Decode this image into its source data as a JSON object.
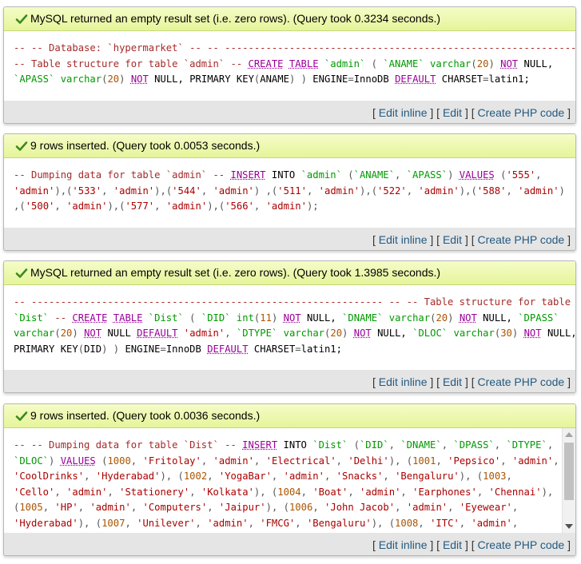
{
  "actions": {
    "edit_inline": "Edit inline",
    "edit": "Edit",
    "create_php": "Create PHP code"
  },
  "colors": {
    "comment": "#a52a2a",
    "keyword": "#990099",
    "type": "#009900",
    "string": "#aa0000",
    "number": "#aa5500",
    "link": "#235a81",
    "message_bg": "#ebf8a4"
  },
  "results": [
    {
      "message": "MySQL returned an empty result set (i.e. zero rows). (Query took 0.3234 seconds.)",
      "icon": "check-icon",
      "sql_lines": [
        [
          [
            "cm",
            "-- -- Database: `hypermarket` -- -- ------------------------------------------------------------ --"
          ]
        ],
        [
          [
            "cm",
            "-- Table structure for table `admin` -- "
          ],
          [
            "kw",
            "CREATE"
          ],
          [
            "nk",
            " "
          ],
          [
            "kw",
            "TABLE"
          ],
          [
            "nk",
            " "
          ],
          [
            "ty",
            "`admin`"
          ],
          [
            "nk",
            " "
          ],
          [
            "pu",
            "("
          ],
          [
            "nk",
            " "
          ],
          [
            "ty",
            "`ANAME`"
          ],
          [
            "nk",
            " "
          ],
          [
            "ty",
            "varchar"
          ],
          [
            "pu",
            "("
          ],
          [
            "nu",
            "20"
          ],
          [
            "pu",
            ")"
          ],
          [
            "nk",
            " "
          ],
          [
            "kw",
            "NOT"
          ],
          [
            "nk",
            " NULL,"
          ]
        ],
        [
          [
            "ty",
            "`APASS`"
          ],
          [
            "nk",
            " "
          ],
          [
            "ty",
            "varchar"
          ],
          [
            "pu",
            "("
          ],
          [
            "nu",
            "20"
          ],
          [
            "pu",
            ")"
          ],
          [
            "nk",
            " "
          ],
          [
            "kw",
            "NOT"
          ],
          [
            "nk",
            " NULL, PRIMARY KEY"
          ],
          [
            "pu",
            "("
          ],
          [
            "nk",
            "ANAME"
          ],
          [
            "pu",
            ")"
          ],
          [
            "nk",
            " "
          ],
          [
            "pu",
            ")"
          ],
          [
            "nk",
            " ENGINE"
          ],
          [
            "pu",
            "="
          ],
          [
            "nk",
            "InnoDB "
          ],
          [
            "kw",
            "DEFAULT"
          ],
          [
            "nk",
            " CHARSET"
          ],
          [
            "pu",
            "="
          ],
          [
            "nk",
            "latin1;"
          ]
        ]
      ]
    },
    {
      "message": "9 rows inserted. (Query took 0.0053 seconds.)",
      "icon": "check-icon",
      "sql_lines": [
        [
          [
            "cm",
            "-- Dumping data for table `admin` -- "
          ],
          [
            "kw",
            "INSERT"
          ],
          [
            "nk",
            " INTO "
          ],
          [
            "ty",
            "`admin`"
          ],
          [
            "nk",
            " "
          ],
          [
            "pu",
            "("
          ],
          [
            "ty",
            "`ANAME`"
          ],
          [
            "pu",
            ", "
          ],
          [
            "ty",
            "`APASS`"
          ],
          [
            "pu",
            ")"
          ],
          [
            "nk",
            " "
          ],
          [
            "kw",
            "VALUES"
          ],
          [
            "nk",
            " "
          ],
          [
            "pu",
            "("
          ],
          [
            "st",
            "'555'"
          ],
          [
            "pu",
            ","
          ]
        ],
        [
          [
            "st",
            "'admin'"
          ],
          [
            "pu",
            "),("
          ],
          [
            "st",
            "'533'"
          ],
          [
            "pu",
            ", "
          ],
          [
            "st",
            "'admin'"
          ],
          [
            "pu",
            "),("
          ],
          [
            "st",
            "'544'"
          ],
          [
            "pu",
            ", "
          ],
          [
            "st",
            "'admin'"
          ],
          [
            "pu",
            ") ,("
          ],
          [
            "st",
            "'511'"
          ],
          [
            "pu",
            ", "
          ],
          [
            "st",
            "'admin'"
          ],
          [
            "pu",
            "),("
          ],
          [
            "st",
            "'522'"
          ],
          [
            "pu",
            ", "
          ],
          [
            "st",
            "'admin'"
          ],
          [
            "pu",
            "),("
          ],
          [
            "st",
            "'588'"
          ],
          [
            "pu",
            ", "
          ],
          [
            "st",
            "'admin'"
          ],
          [
            "pu",
            ")"
          ]
        ],
        [
          [
            "pu",
            ",("
          ],
          [
            "st",
            "'500'"
          ],
          [
            "pu",
            ", "
          ],
          [
            "st",
            "'admin'"
          ],
          [
            "pu",
            "),("
          ],
          [
            "st",
            "'577'"
          ],
          [
            "pu",
            ", "
          ],
          [
            "st",
            "'admin'"
          ],
          [
            "pu",
            "),("
          ],
          [
            "st",
            "'566'"
          ],
          [
            "pu",
            ", "
          ],
          [
            "st",
            "'admin'"
          ],
          [
            "pu",
            ");"
          ]
        ]
      ]
    },
    {
      "message": "MySQL returned an empty result set (i.e. zero rows). (Query took 1.3985 seconds.)",
      "icon": "check-icon",
      "sql_lines": [
        [
          [
            "cm",
            "-- ------------------------------------------------------------ -- -- Table structure for table"
          ]
        ],
        [
          [
            "ty",
            "`Dist`"
          ],
          [
            "nk",
            " "
          ],
          [
            "cm",
            "-- "
          ],
          [
            "kw",
            "CREATE"
          ],
          [
            "nk",
            " "
          ],
          [
            "kw",
            "TABLE"
          ],
          [
            "nk",
            " "
          ],
          [
            "ty",
            "`Dist`"
          ],
          [
            "nk",
            " "
          ],
          [
            "pu",
            "("
          ],
          [
            "nk",
            " "
          ],
          [
            "ty",
            "`DID`"
          ],
          [
            "nk",
            " "
          ],
          [
            "ty",
            "int"
          ],
          [
            "pu",
            "("
          ],
          [
            "nu",
            "11"
          ],
          [
            "pu",
            ")"
          ],
          [
            "nk",
            " "
          ],
          [
            "kw",
            "NOT"
          ],
          [
            "nk",
            " NULL, "
          ],
          [
            "ty",
            "`DNAME`"
          ],
          [
            "nk",
            " "
          ],
          [
            "ty",
            "varchar"
          ],
          [
            "pu",
            "("
          ],
          [
            "nu",
            "20"
          ],
          [
            "pu",
            ")"
          ],
          [
            "nk",
            " "
          ],
          [
            "kw",
            "NOT"
          ],
          [
            "nk",
            " NULL, "
          ],
          [
            "ty",
            "`DPASS`"
          ]
        ],
        [
          [
            "ty",
            "varchar"
          ],
          [
            "pu",
            "("
          ],
          [
            "nu",
            "20"
          ],
          [
            "pu",
            ")"
          ],
          [
            "nk",
            " "
          ],
          [
            "kw",
            "NOT"
          ],
          [
            "nk",
            " NULL "
          ],
          [
            "kw",
            "DEFAULT"
          ],
          [
            "nk",
            " "
          ],
          [
            "st",
            "'admin'"
          ],
          [
            "pu",
            ","
          ],
          [
            "nk",
            " "
          ],
          [
            "ty",
            "`DTYPE`"
          ],
          [
            "nk",
            " "
          ],
          [
            "ty",
            "varchar"
          ],
          [
            "pu",
            "("
          ],
          [
            "nu",
            "20"
          ],
          [
            "pu",
            ")"
          ],
          [
            "nk",
            " "
          ],
          [
            "kw",
            "NOT"
          ],
          [
            "nk",
            " NULL, "
          ],
          [
            "ty",
            "`DLOC`"
          ],
          [
            "nk",
            " "
          ],
          [
            "ty",
            "varchar"
          ],
          [
            "pu",
            "("
          ],
          [
            "nu",
            "30"
          ],
          [
            "pu",
            ")"
          ],
          [
            "nk",
            " "
          ],
          [
            "kw",
            "NOT"
          ],
          [
            "nk",
            " NULL,"
          ]
        ],
        [
          [
            "nk",
            "PRIMARY KEY"
          ],
          [
            "pu",
            "("
          ],
          [
            "nk",
            "DID"
          ],
          [
            "pu",
            ")"
          ],
          [
            "nk",
            " "
          ],
          [
            "pu",
            ")"
          ],
          [
            "nk",
            " ENGINE"
          ],
          [
            "pu",
            "="
          ],
          [
            "nk",
            "InnoDB "
          ],
          [
            "kw",
            "DEFAULT"
          ],
          [
            "nk",
            " CHARSET"
          ],
          [
            "pu",
            "="
          ],
          [
            "nk",
            "latin1;"
          ]
        ]
      ]
    },
    {
      "message": "9 rows inserted. (Query took 0.0036 seconds.)",
      "icon": "check-icon",
      "sql_lines": [
        [
          [
            "cm",
            "-- -- Dumping data for table `Dist` -- "
          ],
          [
            "kw",
            "INSERT"
          ],
          [
            "nk",
            " INTO "
          ],
          [
            "ty",
            "`Dist`"
          ],
          [
            "nk",
            " "
          ],
          [
            "pu",
            "("
          ],
          [
            "ty",
            "`DID`"
          ],
          [
            "pu",
            ", "
          ],
          [
            "ty",
            "`DNAME`"
          ],
          [
            "pu",
            ", "
          ],
          [
            "ty",
            "`DPASS`"
          ],
          [
            "pu",
            ", "
          ],
          [
            "ty",
            "`DTYPE`"
          ],
          [
            "pu",
            ","
          ]
        ],
        [
          [
            "ty",
            "`DLOC`"
          ],
          [
            "pu",
            ")"
          ],
          [
            "nk",
            " "
          ],
          [
            "kw",
            "VALUES"
          ],
          [
            "nk",
            " "
          ],
          [
            "pu",
            "("
          ],
          [
            "nu",
            "1000"
          ],
          [
            "pu",
            ", "
          ],
          [
            "st",
            "'Fritolay'"
          ],
          [
            "pu",
            ", "
          ],
          [
            "st",
            "'admin'"
          ],
          [
            "pu",
            ", "
          ],
          [
            "st",
            "'Electrical'"
          ],
          [
            "pu",
            ", "
          ],
          [
            "st",
            "'Delhi'"
          ],
          [
            "pu",
            "), ("
          ],
          [
            "nu",
            "1001"
          ],
          [
            "pu",
            ", "
          ],
          [
            "st",
            "'Pepsico'"
          ],
          [
            "pu",
            ", "
          ],
          [
            "st",
            "'admin'"
          ],
          [
            "pu",
            ","
          ]
        ],
        [
          [
            "st",
            "'CoolDrinks'"
          ],
          [
            "pu",
            ", "
          ],
          [
            "st",
            "'Hyderabad'"
          ],
          [
            "pu",
            "), ("
          ],
          [
            "nu",
            "1002"
          ],
          [
            "pu",
            ", "
          ],
          [
            "st",
            "'YogaBar'"
          ],
          [
            "pu",
            ", "
          ],
          [
            "st",
            "'admin'"
          ],
          [
            "pu",
            ", "
          ],
          [
            "st",
            "'Snacks'"
          ],
          [
            "pu",
            ", "
          ],
          [
            "st",
            "'Bengaluru'"
          ],
          [
            "pu",
            "), ("
          ],
          [
            "nu",
            "1003"
          ],
          [
            "pu",
            ","
          ]
        ],
        [
          [
            "st",
            "'Cello'"
          ],
          [
            "pu",
            ", "
          ],
          [
            "st",
            "'admin'"
          ],
          [
            "pu",
            ", "
          ],
          [
            "st",
            "'Stationery'"
          ],
          [
            "pu",
            ", "
          ],
          [
            "st",
            "'Kolkata'"
          ],
          [
            "pu",
            "), ("
          ],
          [
            "nu",
            "1004"
          ],
          [
            "pu",
            ", "
          ],
          [
            "st",
            "'Boat'"
          ],
          [
            "pu",
            ", "
          ],
          [
            "st",
            "'admin'"
          ],
          [
            "pu",
            ", "
          ],
          [
            "st",
            "'Earphones'"
          ],
          [
            "pu",
            ", "
          ],
          [
            "st",
            "'Chennai'"
          ],
          [
            "pu",
            "),"
          ]
        ],
        [
          [
            "pu",
            "("
          ],
          [
            "nu",
            "1005"
          ],
          [
            "pu",
            ", "
          ],
          [
            "st",
            "'HP'"
          ],
          [
            "pu",
            ", "
          ],
          [
            "st",
            "'admin'"
          ],
          [
            "pu",
            ", "
          ],
          [
            "st",
            "'Computers'"
          ],
          [
            "pu",
            ", "
          ],
          [
            "st",
            "'Jaipur'"
          ],
          [
            "pu",
            "), ("
          ],
          [
            "nu",
            "1006"
          ],
          [
            "pu",
            ", "
          ],
          [
            "st",
            "'John Jacob'"
          ],
          [
            "pu",
            ", "
          ],
          [
            "st",
            "'admin'"
          ],
          [
            "pu",
            ", "
          ],
          [
            "st",
            "'Eyewear'"
          ],
          [
            "pu",
            ","
          ]
        ],
        [
          [
            "st",
            "'Hyderabad'"
          ],
          [
            "pu",
            "), ("
          ],
          [
            "nu",
            "1007"
          ],
          [
            "pu",
            ", "
          ],
          [
            "st",
            "'Unilever'"
          ],
          [
            "pu",
            ", "
          ],
          [
            "st",
            "'admin'"
          ],
          [
            "pu",
            ", "
          ],
          [
            "st",
            "'FMCG'"
          ],
          [
            "pu",
            ", "
          ],
          [
            "st",
            "'Bengaluru'"
          ],
          [
            "pu",
            "), ("
          ],
          [
            "nu",
            "1008"
          ],
          [
            "pu",
            ", "
          ],
          [
            "st",
            "'ITC'"
          ],
          [
            "pu",
            ", "
          ],
          [
            "st",
            "'admin'"
          ],
          [
            "pu",
            ","
          ]
        ]
      ]
    }
  ]
}
